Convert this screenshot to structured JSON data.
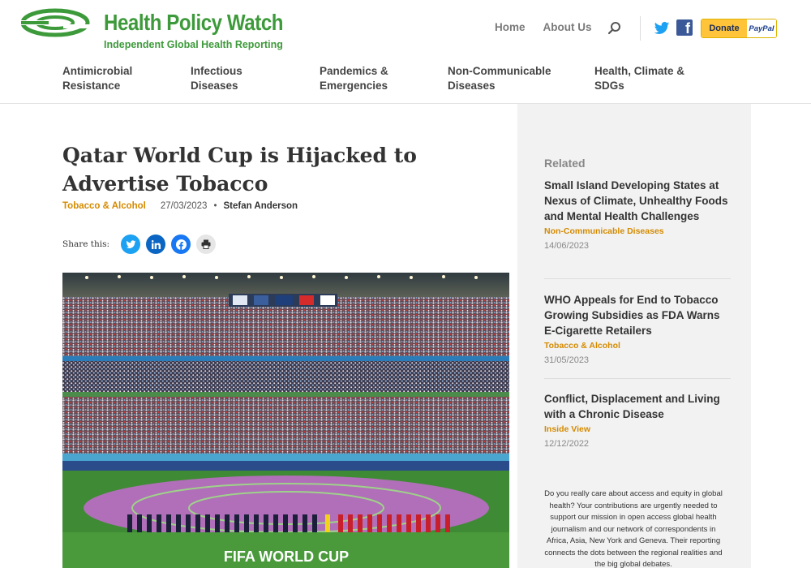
{
  "brand": {
    "name": "Health Policy Watch",
    "tagline": "Independent Global Health Reporting",
    "color": "#3d9a3a"
  },
  "topnav": {
    "items": [
      "Home",
      "About Us"
    ],
    "search_icon": "search-icon",
    "social": [
      "twitter-icon",
      "facebook-icon"
    ],
    "donate_label": "Donate",
    "paypal_label": "PayPal"
  },
  "categories": [
    {
      "line1": "Antimicrobial",
      "line2": "Resistance"
    },
    {
      "line1": "Infectious",
      "line2": "Diseases"
    },
    {
      "line1": "Pandemics &",
      "line2": "Emergencies"
    },
    {
      "line1": "Non-Communicable",
      "line2": "Diseases"
    },
    {
      "line1": "Health, Climate &",
      "line2": "SDGs"
    }
  ],
  "article": {
    "title": "Qatar World Cup is Hijacked to Advertise Tobacco",
    "category": "Tobacco & Alcohol",
    "date": "27/03/2023",
    "separator": "•",
    "author": "Stefan Anderson",
    "share_label": "Share this:",
    "share_icons": [
      "twitter-icon",
      "linkedin-icon",
      "facebook-icon",
      "print-icon"
    ],
    "image_banner": "FIFA WORLD CUP"
  },
  "sidebar": {
    "heading": "Related",
    "related": [
      {
        "title": "Small Island Developing States at Nexus of Climate, Unhealthy Foods and Mental Health Challenges",
        "category": "Non-Communicable Diseases",
        "date": "14/06/2023"
      },
      {
        "title": "WHO Appeals for End to Tobacco Growing Subsidies as FDA Warns E-Cigarette Retailers",
        "category": "Tobacco & Alcohol",
        "date": "31/05/2023"
      },
      {
        "title": "Conflict, Displacement and Living with a Chronic Disease",
        "category": "Inside View",
        "date": "12/12/2022"
      }
    ],
    "support_text": "Do you really care about access and equity in global health? Your contributions are urgently needed to support our mission in open access global health journalism and our network of correspondents in Africa, Asia, New York and Geneva. Their reporting connects the dots between the regional realities and the big global debates."
  },
  "colors": {
    "accent": "#d48a00",
    "sidebar_bg": "#f2f2f2",
    "twitter": "#1da1f2",
    "linkedin": "#0a66c2",
    "facebook": "#1877f2",
    "print": "#e6e6e6",
    "donate": "#ffc439"
  }
}
